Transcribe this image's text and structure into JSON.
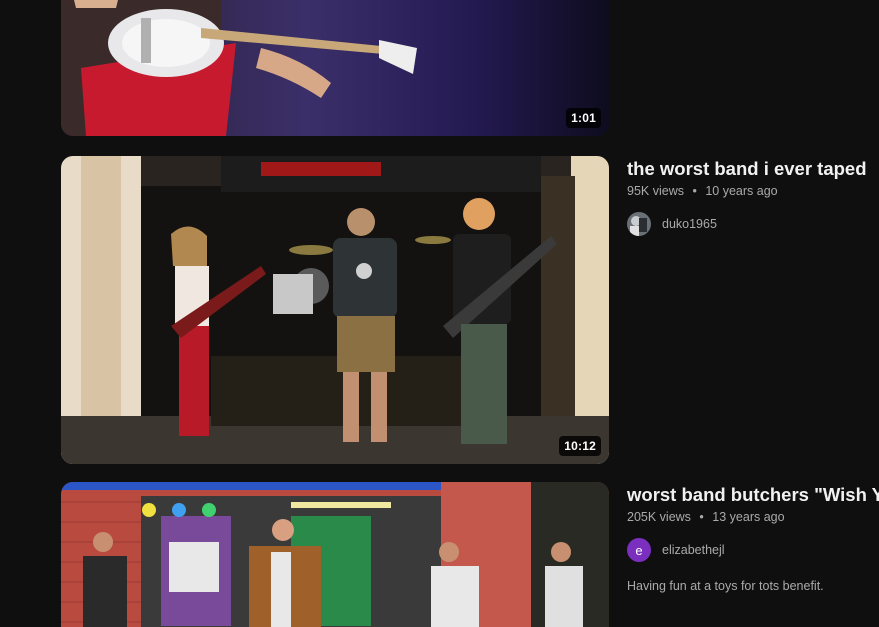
{
  "videos": [
    {
      "title": "",
      "duration": "1:01"
    },
    {
      "title": "the worst band i ever taped",
      "views": "95K views",
      "age": "10 years ago",
      "channel": "duko1965",
      "duration": "10:12"
    },
    {
      "title": "worst band butchers \"Wish Y",
      "views": "205K views",
      "age": "13 years ago",
      "channel": "elizabethejl",
      "avatar_letter": "e",
      "avatar_color": "#7b2fbe",
      "description": "Having fun at a toys for tots benefit.",
      "duration": ""
    }
  ],
  "separator": "•"
}
